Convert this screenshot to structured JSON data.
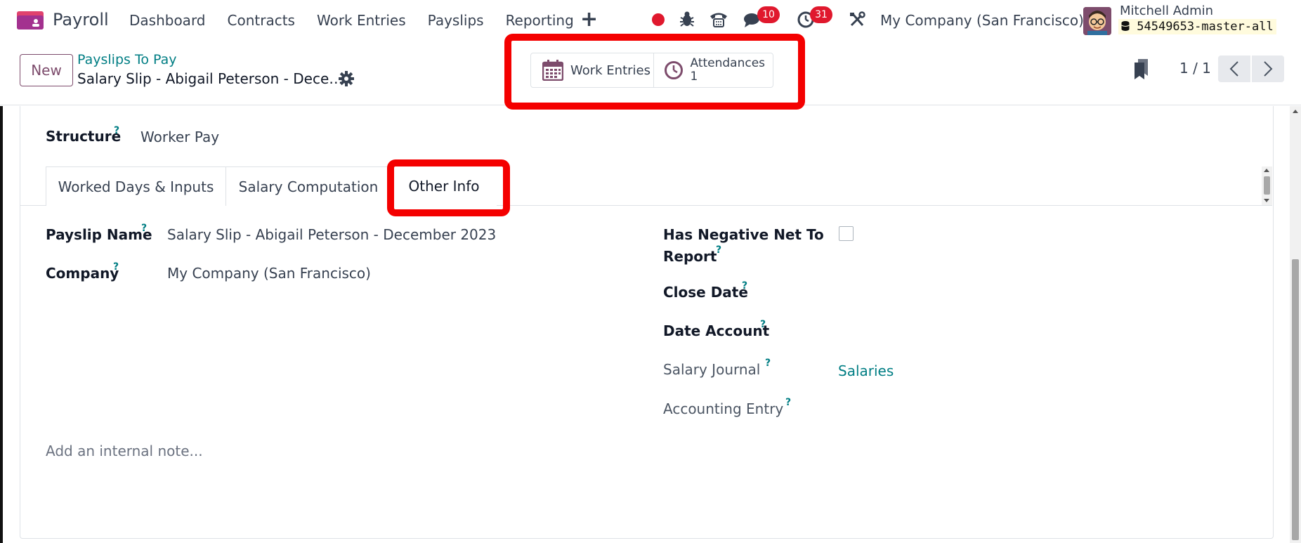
{
  "navbar": {
    "app_name": "Payroll",
    "menu": [
      "Dashboard",
      "Contracts",
      "Work Entries",
      "Payslips",
      "Reporting"
    ],
    "plus_label": "+",
    "messages_count": "10",
    "activities_count": "31",
    "company": "My Company (San Francisco)",
    "user_name": "Mitchell Admin",
    "database": "54549653-master-all",
    "brand_color": "#7d4c6c",
    "alert_color": "#e0182d"
  },
  "control_panel": {
    "new_label": "New",
    "breadcrumb_parent": "Payslips To Pay",
    "breadcrumb_current": "Salary Slip - Abigail Peterson - Dece…",
    "smart_buttons": {
      "work_entries_label": "Work Entries",
      "attendances_label": "Attendances",
      "attendances_count": "1"
    },
    "pager_value": "1 / 1"
  },
  "form": {
    "structure_label": "Structure",
    "structure_value": "Worker Pay",
    "help_mark": "?",
    "tabs": [
      {
        "label": "Worked Days & Inputs"
      },
      {
        "label": "Salary Computation"
      },
      {
        "label": "Other Info"
      }
    ],
    "active_tab": "Other Info",
    "other_info": {
      "payslip_name_label": "Payslip Name",
      "payslip_name_value": "Salary Slip - Abigail Peterson - December 2023",
      "company_label": "Company",
      "company_value": "My Company (San Francisco)",
      "has_negative_label_line1": "Has Negative Net To",
      "has_negative_label_line2": "Report",
      "close_date_label": "Close Date",
      "date_account_label": "Date Account",
      "salary_journal_label": "Salary Journal",
      "salary_journal_value": "Salaries",
      "accounting_entry_label": "Accounting Entry"
    },
    "note_placeholder": "Add an internal note..."
  },
  "highlight_color": "#f40000",
  "link_color": "#017e84"
}
